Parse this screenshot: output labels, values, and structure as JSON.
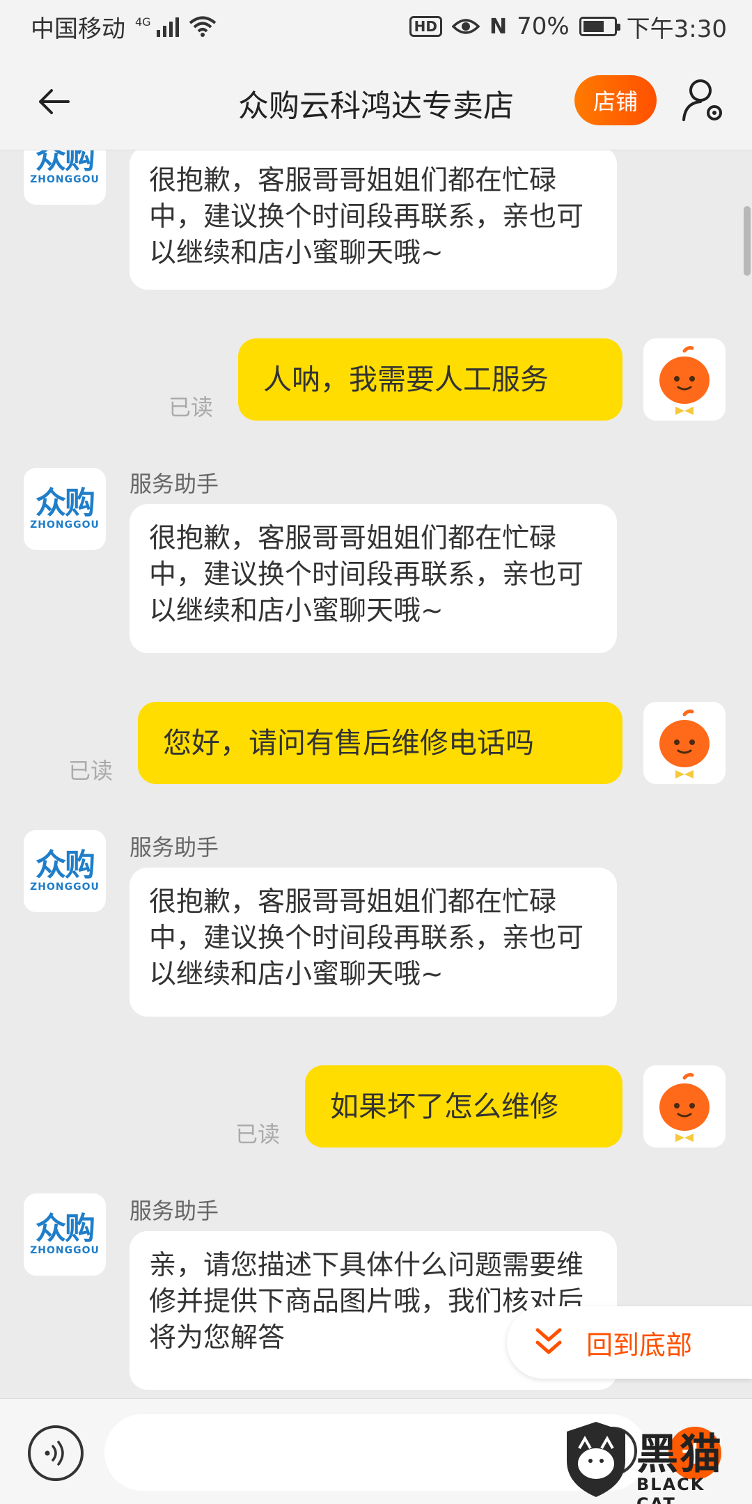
{
  "status_bar": {
    "carrier": "中国移动",
    "network_type": "4G",
    "hd_badge": "HD",
    "battery_percent": "70%",
    "battery_level": 0.7,
    "time": "下午3:30",
    "icons": [
      "signal-icon",
      "wifi-icon",
      "eye-icon",
      "nfc-icon",
      "battery-icon"
    ]
  },
  "header": {
    "title": "众购云科鸿达专卖店",
    "shop_button": "店铺",
    "icons": [
      "back-arrow-icon",
      "user-settings-icon"
    ]
  },
  "shop_logo": {
    "cn": "众购",
    "en": "ZHONGGOU"
  },
  "messages": [
    {
      "from": "shop",
      "text": "很抱歉，客服哥哥姐姐们都在忙碌中，建议换个时间段再联系，亲也可以继续和店小蜜聊天哦~"
    },
    {
      "from": "user",
      "text": "人呐，我需要人工服务",
      "status": "已读"
    },
    {
      "from": "shop",
      "sender": "服务助手",
      "text": "很抱歉，客服哥哥姐姐们都在忙碌中，建议换个时间段再联系，亲也可以继续和店小蜜聊天哦~"
    },
    {
      "from": "user",
      "text": "您好，请问有售后维修电话吗",
      "status": "已读"
    },
    {
      "from": "shop",
      "sender": "服务助手",
      "text": "很抱歉，客服哥哥姐姐们都在忙碌中，建议换个时间段再联系，亲也可以继续和店小蜜聊天哦~"
    },
    {
      "from": "user",
      "text": "如果坏了怎么维修",
      "status": "已读"
    },
    {
      "from": "shop",
      "sender": "服务助手",
      "text": "亲，请您描述下具体什么问题需要维修并提供下商品图片哦，我们核对后将为您解答"
    }
  ],
  "back_to_bottom": {
    "label": "回到底部",
    "icon": "double-chevron-down-icon"
  },
  "input_bar": {
    "icons": [
      "voice-icon",
      "emoji-icon",
      "plus-icon"
    ],
    "plus_label": "+"
  },
  "watermark": {
    "cn": "黑猫",
    "en": "BLACK CAT"
  },
  "colors": {
    "accent_orange": "#ff5000",
    "bubble_yellow": "#ffdd00",
    "logo_blue": "#1f7ec9",
    "background": "#ebebeb"
  }
}
